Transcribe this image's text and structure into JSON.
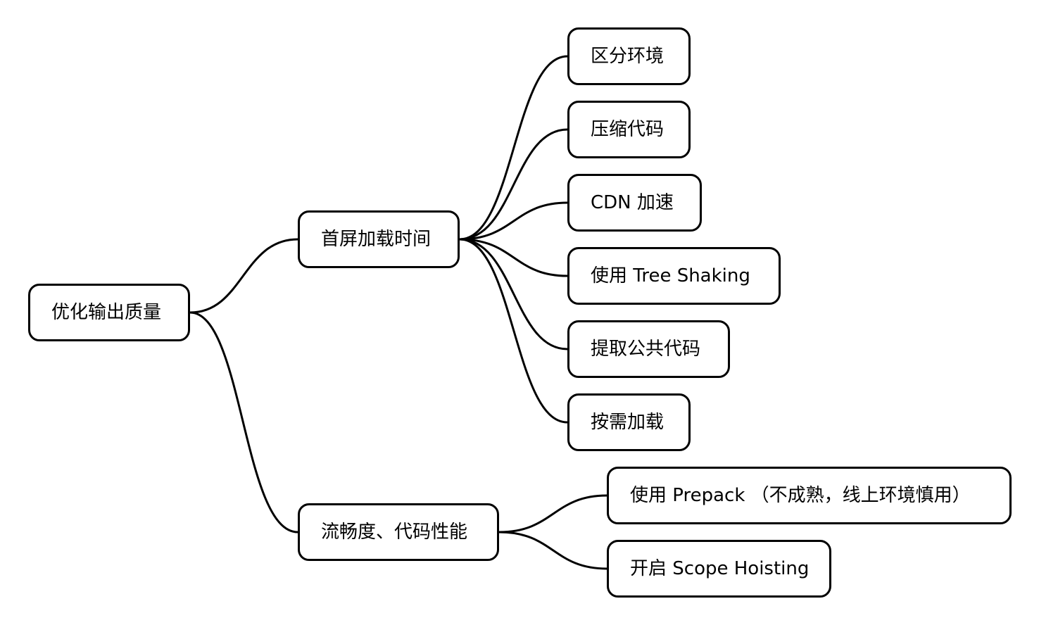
{
  "mindmap": {
    "root": {
      "label": "优化输出质量"
    },
    "branches": [
      {
        "label": "首屏加载时间",
        "children": [
          {
            "label": "区分环境"
          },
          {
            "label": "压缩代码"
          },
          {
            "label": "CDN 加速"
          },
          {
            "label": "使用  Tree Shaking"
          },
          {
            "label": "提取公共代码"
          },
          {
            "label": "按需加载"
          }
        ]
      },
      {
        "label": "流畅度、代码性能",
        "children": [
          {
            "label": "使用 Prepack （不成熟，线上环境慎用）"
          },
          {
            "label": "开启 Scope Hoisting"
          }
        ]
      }
    ]
  }
}
